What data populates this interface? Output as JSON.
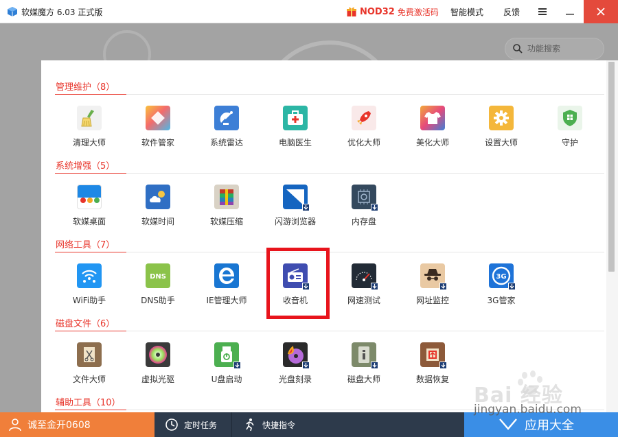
{
  "window": {
    "title": "软媒魔方 6.03 正式版",
    "promo_product": "NOD32",
    "promo_offer": "免费激活码",
    "mode_link": "智能模式",
    "feedback_link": "反馈"
  },
  "search": {
    "placeholder": "功能搜索"
  },
  "sections": [
    {
      "title": "管理维护（8）",
      "tools": [
        {
          "label": "清理大师",
          "icon": "broom-icon",
          "color": "#f2f2f2"
        },
        {
          "label": "软件管家",
          "icon": "software-manager-icon",
          "color": "#f35d6b"
        },
        {
          "label": "系统雷达",
          "icon": "radar-icon",
          "color": "#3d7fd6"
        },
        {
          "label": "电脑医生",
          "icon": "medkit-icon",
          "color": "#2cb6a5"
        },
        {
          "label": "优化大师",
          "icon": "rocket-icon",
          "color": "#f7e6e6"
        },
        {
          "label": "美化大师",
          "icon": "tshirt-icon",
          "color": "#e64a7b"
        },
        {
          "label": "设置大师",
          "icon": "gear-icon",
          "color": "#f4b73b"
        },
        {
          "label": "守护",
          "icon": "shield-icon",
          "color": "#4caf50"
        }
      ]
    },
    {
      "title": "系统增强（5）",
      "tools": [
        {
          "label": "软媒桌面",
          "icon": "desktop-icon",
          "color": "#1e88e5"
        },
        {
          "label": "软媒时间",
          "icon": "weather-clock-icon",
          "color": "#2f6fc4"
        },
        {
          "label": "软媒压缩",
          "icon": "archive-icon",
          "color": "#7a5b3a"
        },
        {
          "label": "闪游浏览器",
          "icon": "browser-icon",
          "color": "#1565c0"
        },
        {
          "label": "内存盘",
          "icon": "ramdisk-icon",
          "color": "#34495e"
        }
      ]
    },
    {
      "title": "网络工具（7）",
      "tools": [
        {
          "label": "WiFi助手",
          "icon": "wifi-icon",
          "color": "#2196f3"
        },
        {
          "label": "DNS助手",
          "icon": "dns-icon",
          "color": "#8bc34a"
        },
        {
          "label": "IE管理大师",
          "icon": "ie-icon",
          "color": "#1976d2"
        },
        {
          "label": "收音机",
          "icon": "radio-icon",
          "color": "#3f4db0"
        },
        {
          "label": "网速测试",
          "icon": "speedometer-icon",
          "color": "#222b36"
        },
        {
          "label": "网址监控",
          "icon": "spy-icon",
          "color": "#e9c9a3"
        },
        {
          "label": "3G管家",
          "icon": "3g-icon",
          "color": "#1e73d8"
        }
      ]
    },
    {
      "title": "磁盘文件（6）",
      "tools": [
        {
          "label": "文件大师",
          "icon": "file-tools-icon",
          "color": "#8d6e4e"
        },
        {
          "label": "虚拟光驱",
          "icon": "disc-icon",
          "color": "#3a3a3a"
        },
        {
          "label": "U盘启动",
          "icon": "usb-icon",
          "color": "#4caf50"
        },
        {
          "label": "光盘刻录",
          "icon": "burn-disc-icon",
          "color": "#2a2a2a"
        },
        {
          "label": "磁盘大师",
          "icon": "hdd-icon",
          "color": "#7d8a6a"
        },
        {
          "label": "数据恢复",
          "icon": "recovery-icon",
          "color": "#8d5a3a"
        }
      ]
    },
    {
      "title": "辅助工具（10）",
      "tools": []
    }
  ],
  "bottom": {
    "user": "诚至金开0608",
    "scheduled_tasks": "定时任务",
    "quick_commands": "快捷指令",
    "all_apps": "应用大全"
  },
  "watermark": {
    "brand": "Bai 经验",
    "url": "jingyan.baidu.com"
  }
}
